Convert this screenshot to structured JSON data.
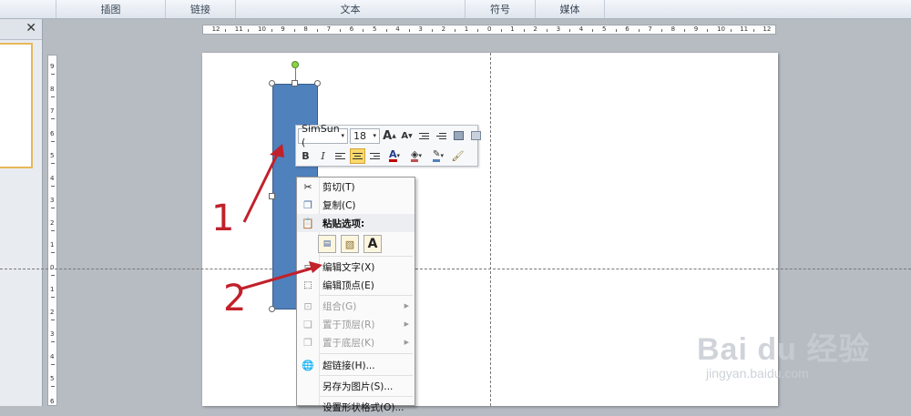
{
  "ribbon": {
    "groups": [
      "插图",
      "链接",
      "文本",
      "符号",
      "媒体"
    ]
  },
  "pane": {
    "close_glyph": "✕"
  },
  "ruler": {
    "h_labels": [
      "12",
      "11",
      "10",
      "9",
      "8",
      "7",
      "6",
      "5",
      "4",
      "3",
      "2",
      "1",
      "0",
      "1",
      "2",
      "3",
      "4",
      "5",
      "6",
      "7",
      "8",
      "9",
      "10",
      "11",
      "12"
    ],
    "v_labels": [
      "9",
      "8",
      "7",
      "6",
      "5",
      "4",
      "3",
      "2",
      "1",
      "0",
      "1",
      "2",
      "3",
      "4",
      "5",
      "6"
    ]
  },
  "mini_toolbar": {
    "font_name": "SimSun (",
    "font_size": "18",
    "bold": "B",
    "italic": "I",
    "font_color": "A",
    "grow_font": "A",
    "shrink_font": "A"
  },
  "context_menu": {
    "cut": "剪切(T)",
    "copy": "复制(C)",
    "paste_options": "粘贴选项:",
    "edit_text": "编辑文字(X)",
    "edit_points": "编辑顶点(E)",
    "group": "组合(G)",
    "bring_front": "置于顶层(R)",
    "send_back": "置于底层(K)",
    "hyperlink": "超链接(H)...",
    "save_as_picture": "另存为图片(S)...",
    "last_item": "设置形状格式(O)..."
  },
  "annotations": {
    "one": "1",
    "two": "2"
  },
  "watermark": {
    "logo": "Bai du 经验",
    "url": "jingyan.baidu.com"
  },
  "colors": {
    "shape_fill": "#4f81bd",
    "arrow": "#c1212b",
    "highlight": "#fbd96b"
  }
}
